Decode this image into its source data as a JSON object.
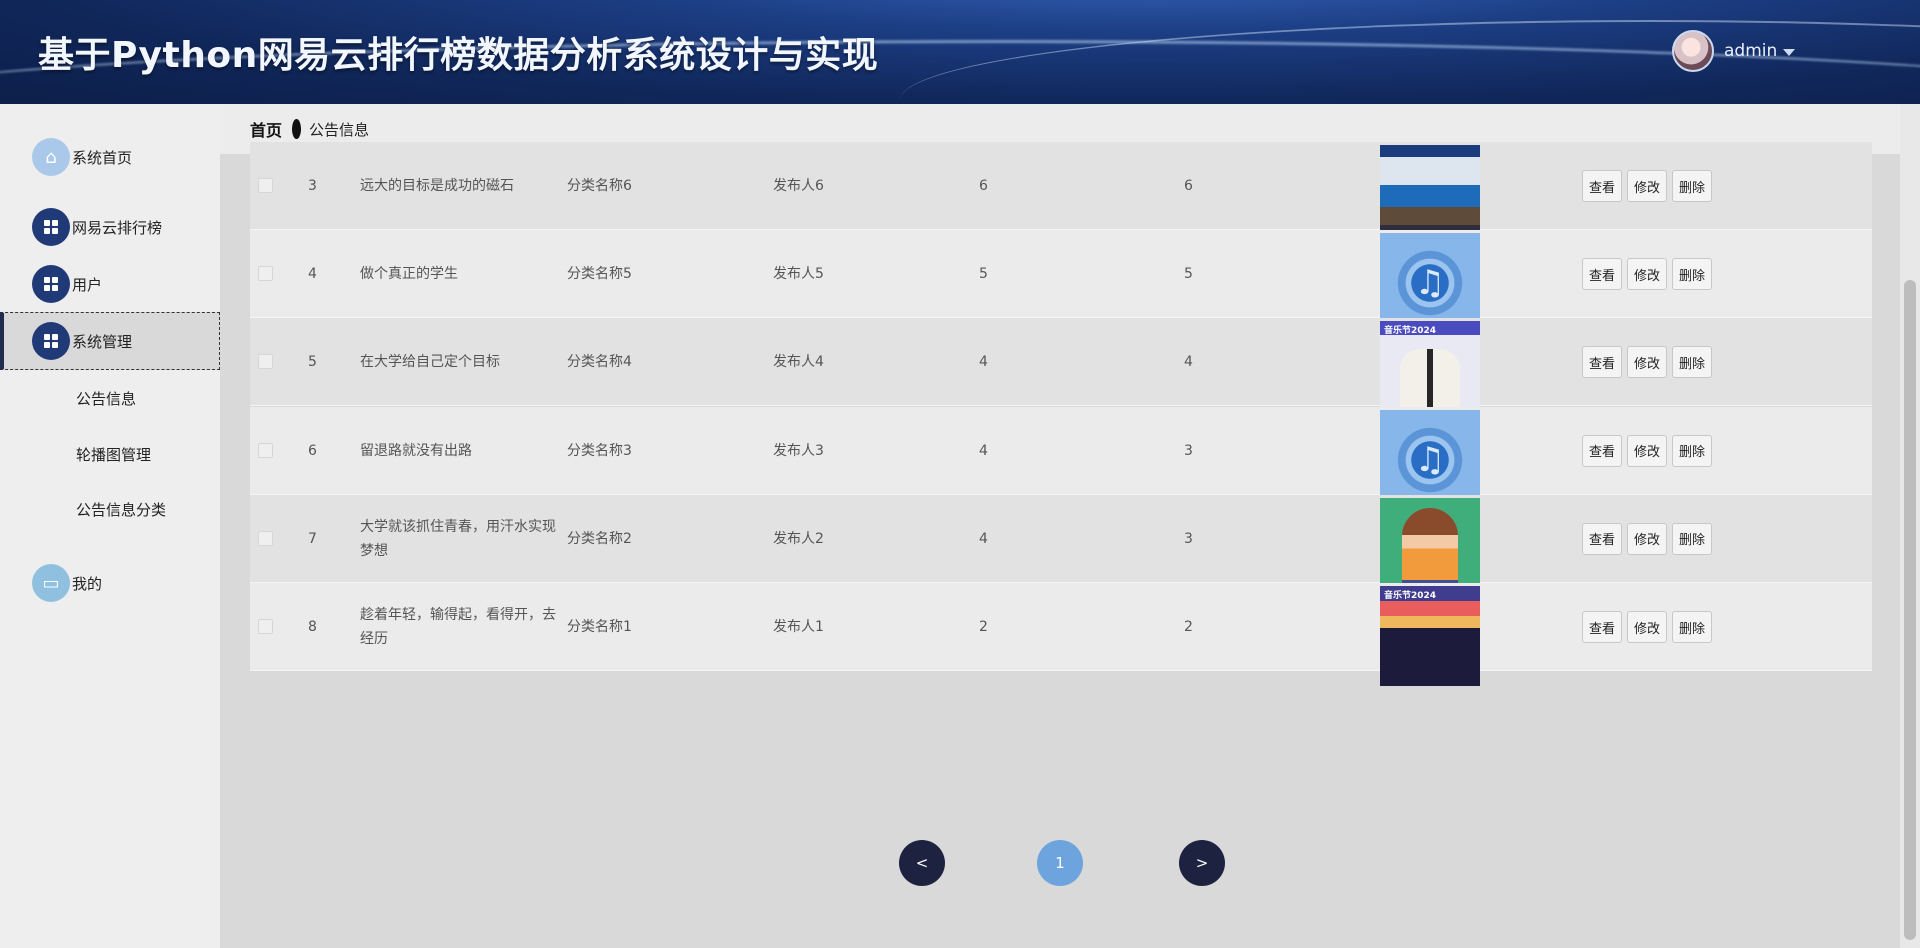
{
  "header": {
    "title": "基于Python网易云排行榜数据分析系统设计与实现",
    "user_name": "admin"
  },
  "sidebar": {
    "items": [
      {
        "label": "系统首页",
        "icon": "home-icon"
      },
      {
        "label": "网易云排行榜",
        "icon": "grid-icon"
      },
      {
        "label": "用户",
        "icon": "grid-icon"
      },
      {
        "label": "系统管理",
        "icon": "grid-icon"
      },
      {
        "label": "我的",
        "icon": "card-icon"
      }
    ],
    "sub_items": [
      {
        "label": "公告信息"
      },
      {
        "label": "轮播图管理"
      },
      {
        "label": "公告信息分类"
      }
    ]
  },
  "breadcrumb": {
    "home": "首页",
    "current": "公告信息"
  },
  "table": {
    "rows": [
      {
        "index": "3",
        "title": "远大的目标是成功的磁石",
        "category": "分类名称6",
        "publisher": "发布人6",
        "col5": "6",
        "col6": "6",
        "image": "school-poster"
      },
      {
        "index": "4",
        "title": "做个真正的学生",
        "category": "分类名称5",
        "publisher": "发布人5",
        "col5": "5",
        "col6": "5",
        "image": "music-icon"
      },
      {
        "index": "5",
        "title": "在大学给自己定个目标",
        "category": "分类名称4",
        "publisher": "发布人4",
        "col5": "4",
        "col6": "4",
        "image": "festival-poster"
      },
      {
        "index": "6",
        "title": "留退路就没有出路",
        "category": "分类名称3",
        "publisher": "发布人3",
        "col5": "4",
        "col6": "3",
        "image": "music-icon"
      },
      {
        "index": "7",
        "title": "大学就该抓住青春，用汗水实现梦想",
        "category": "分类名称2",
        "publisher": "发布人2",
        "col5": "4",
        "col6": "3",
        "image": "girl-illustration"
      },
      {
        "index": "8",
        "title": "趁着年轻，输得起，看得开，去经历",
        "category": "分类名称1",
        "publisher": "发布人1",
        "col5": "2",
        "col6": "2",
        "image": "festival-poster"
      }
    ],
    "actions": {
      "view": "查看",
      "edit": "修改",
      "delete": "删除"
    },
    "poster_text": {
      "fest": "音乐节2024"
    }
  },
  "pagination": {
    "prev": "<",
    "current": "1",
    "next": ">"
  },
  "colors": {
    "header_bg": "#1d3f86",
    "sidebar_icon_dark": "#1f3a76",
    "pager_dark": "#1c2240",
    "pager_current": "#6ea4dd"
  }
}
